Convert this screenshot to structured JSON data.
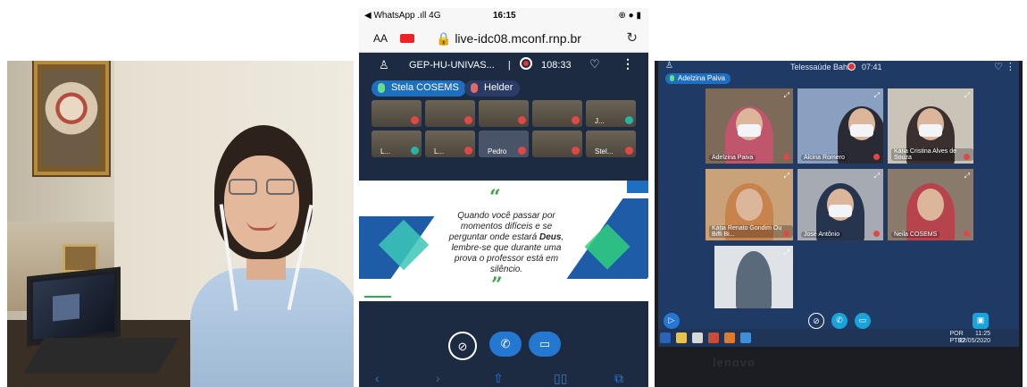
{
  "phone": {
    "status": {
      "carrier": "◀ WhatsApp .ıll 4G",
      "time": "16:15",
      "right_icons": "⊕ ● ▮"
    },
    "browser": {
      "aa_label": "AA",
      "url": "🔒 live-idc08.mconf.rnp.br",
      "reload": "↻"
    },
    "meeting": {
      "title": "GEP-HU-UNIVAS...",
      "separator": "|",
      "duration": "108:33",
      "speakers": [
        "Stela COSEMS",
        "Helder"
      ],
      "thumbnails": [
        "",
        "",
        "",
        "",
        "J...",
        "L...",
        "L...",
        "Pedro",
        "",
        "Stel..."
      ]
    },
    "slide": {
      "open_quote": "“",
      "close_quote": "”",
      "quote_pre": "Quando você passar por momentos difíceis e se perguntar onde estará ",
      "quote_bold": "Deus",
      "quote_post": ", lembre-se que durante uma prova o professor está em silêncio."
    }
  },
  "laptop": {
    "window_title": "Telessaúde Bahia",
    "duration": "07:41",
    "speaker": "Adelzina Paiva",
    "participants": [
      {
        "name": "Adelzina Paiva"
      },
      {
        "name": "Alcina Romero"
      },
      {
        "name": "Kátia Cristina Alves de Souza"
      },
      {
        "name": "Kátia Renato Gondim Ou Biffi Bi..."
      },
      {
        "name": "José Antônio"
      },
      {
        "name": "Neila COSEMS"
      },
      {
        "name": ""
      }
    ],
    "taskbar": {
      "lang": "POR\nPTB2",
      "clock": "11:25\n22/05/2020"
    },
    "brand": "lenovo"
  },
  "colors": {
    "accent_blue": "#1e6fbf",
    "dark_navy": "#1c2a42",
    "green_quote": "#3aa84a",
    "record_red": "#e33333"
  }
}
